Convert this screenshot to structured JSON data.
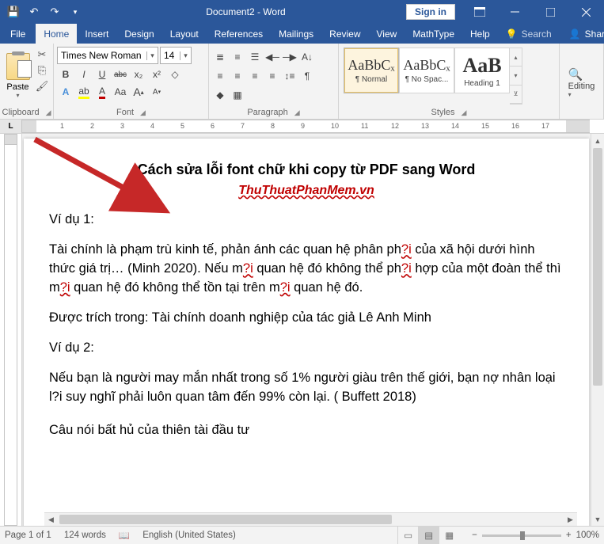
{
  "titlebar": {
    "doc_title": "Document2 - Word",
    "signin": "Sign in"
  },
  "tabs": {
    "file": "File",
    "home": "Home",
    "insert": "Insert",
    "design": "Design",
    "layout": "Layout",
    "references": "References",
    "mailings": "Mailings",
    "review": "Review",
    "view": "View",
    "mathtype": "MathType",
    "help": "Help",
    "tellme": "Search",
    "share": "Share"
  },
  "ribbon": {
    "clipboard": {
      "label": "Clipboard",
      "paste": "Paste"
    },
    "font": {
      "label": "Font",
      "name": "Times New Roman",
      "size": "14",
      "bold": "B",
      "italic": "I",
      "underline": "U",
      "strike": "abc",
      "sub": "x₂",
      "sup": "x²",
      "aa1": "Aa",
      "aa2": "A",
      "aa3": "A"
    },
    "paragraph": {
      "label": "Paragraph"
    },
    "styles": {
      "label": "Styles",
      "items": [
        {
          "preview": "AaBbCₓ",
          "name": "¶ Normal"
        },
        {
          "preview": "AaBbCₓ",
          "name": "¶ No Spac..."
        },
        {
          "preview": "AaB",
          "name": "Heading 1"
        }
      ]
    },
    "editing": {
      "label": "Editing"
    }
  },
  "ruler": {
    "numbers": [
      "1",
      "2",
      "3",
      "4",
      "5",
      "6",
      "7",
      "8",
      "9",
      "10",
      "11",
      "12",
      "13",
      "14",
      "15",
      "16",
      "17"
    ]
  },
  "document": {
    "title": "Cách sửa lỗi font chữ khi copy từ PDF sang Word",
    "subtitle": "ThuThuatPhanMem.vn",
    "ex1_label": "Ví dụ 1:",
    "p1a": "Tài chính là phạm trù kinh tế, phản ánh các quan hệ phân ph",
    "p1a_err": "?i",
    "p1b": " của xã hội dưới hình thức giá trị… (Minh 2020). Nếu m",
    "p1b_err": "?i",
    "p1c": " quan hệ đó không thể ph",
    "p1c_err": "?i",
    "p1d": " hợp của một đoàn thể thì m",
    "p1d_err": "?i",
    "p1e": " quan hệ đó không thể tồ",
    "p1e2": "n tại trên m",
    "p1e_err": "?i",
    "p1f": " quan hệ đó.",
    "p2": "Được trích trong: Tài chính doanh nghiệp của tác giả Lê Anh Minh",
    "ex2_label": "Ví dụ 2:",
    "p3a": "Nếu bạn là người may mắn nhất trong số 1% người giàu trên thế giới, bạn nợ nhân loại l?i suy nghĩ phải luôn quan tâm đến 99% còn lại. ( Buffett 2018)",
    "p4": "Câu nói bất hủ của thiên tài đầu tư"
  },
  "statusbar": {
    "page": "Page 1 of 1",
    "words": "124 words",
    "lang": "English (United States)",
    "zoom": "100%"
  }
}
